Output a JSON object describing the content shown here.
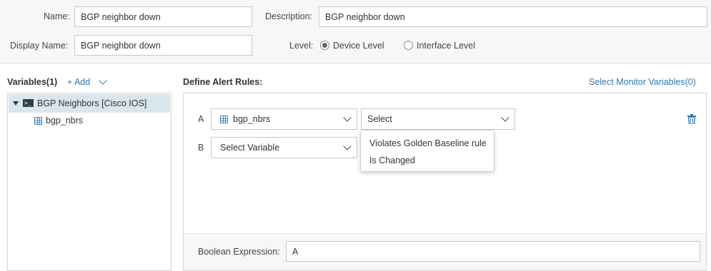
{
  "form": {
    "name_label": "Name:",
    "name_value": "BGP neighbor down",
    "description_label": "Description:",
    "description_value": "BGP neighbor down",
    "display_name_label": "Display Name:",
    "display_name_value": "BGP neighbor down",
    "level_label": "Level:",
    "level_options": [
      "Device Level",
      "Interface Level"
    ],
    "level_selected": "Device Level"
  },
  "variables": {
    "title": "Variables(1)",
    "add_label": "+ Add",
    "tree": [
      {
        "label": "BGP Neighbors [Cisco IOS]",
        "icon": "terminal-icon",
        "expanded": true,
        "selected": true
      },
      {
        "label": "bgp_nbrs",
        "icon": "table-icon"
      }
    ]
  },
  "rules": {
    "title": "Define Alert Rules:",
    "monitor_link": "Select Monitor Variables(0)",
    "rows": [
      {
        "letter": "A",
        "variable": "bgp_nbrs",
        "condition": "Select"
      },
      {
        "letter": "B",
        "variable": "Select Variable"
      }
    ],
    "menu_options": [
      "Violates Golden Baseline rule",
      "Is Changed"
    ],
    "boolean_label": "Boolean Expression:",
    "boolean_value": "A"
  },
  "colors": {
    "link": "#2b7bb9",
    "selected_row": "#d9e6ee"
  }
}
